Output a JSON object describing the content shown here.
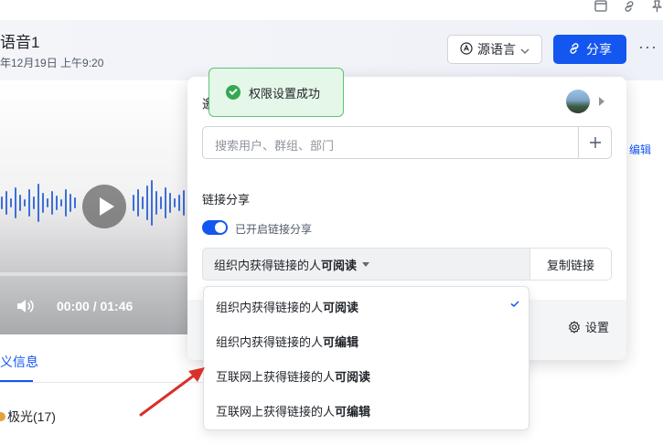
{
  "recording": {
    "title": "语音1",
    "date": "年12月19日 上午9:20",
    "time_display": "00:00 / 01:46",
    "tab_label": "义信息",
    "speaker": "极光(17)",
    "edit_link": "编辑"
  },
  "header_actions": {
    "source_lang_label": "源语言",
    "share_label": "分享",
    "more_label": "···"
  },
  "share_panel": {
    "heading_partial": "邀",
    "search_placeholder": "搜索用户、群组、部门",
    "link_share_title": "链接分享",
    "toggle_label": "已开启链接分享",
    "toggle_on": true,
    "permission_prefix": "组织内获得链接的人",
    "permission_bold": "可阅读",
    "copy_link_label": "复制链接",
    "settings_label": "设置"
  },
  "toast": {
    "message": "权限设置成功"
  },
  "permission_options": [
    {
      "prefix": "组织内获得链接的人",
      "bold": "可阅读",
      "selected": true
    },
    {
      "prefix": "组织内获得链接的人",
      "bold": "可编辑",
      "selected": false
    },
    {
      "prefix": "互联网上获得链接的人",
      "bold": "可阅读",
      "selected": false
    },
    {
      "prefix": "互联网上获得链接的人",
      "bold": "可编辑",
      "selected": false
    }
  ],
  "colors": {
    "primary": "#1456f0",
    "toast_bg": "#e4f7e8",
    "toast_border": "#5fc373",
    "annotation_arrow": "#d9302b"
  }
}
